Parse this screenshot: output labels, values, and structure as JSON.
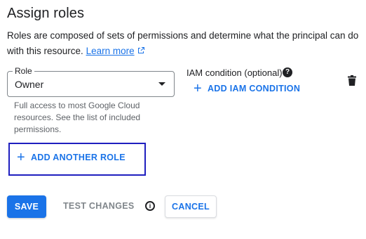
{
  "header": {
    "title": "Assign roles"
  },
  "description": {
    "text": "Roles are composed of sets of permissions and determine what the principal can do with this resource.",
    "link_label": "Learn more"
  },
  "role": {
    "label": "Role",
    "value": "Owner",
    "help": "Full access to most Google Cloud resources. See the list of included permissions."
  },
  "iam_condition": {
    "label": "IAM condition (optional)",
    "help_icon_text": "?",
    "add_label": "ADD IAM CONDITION"
  },
  "add_role": {
    "label": "ADD ANOTHER ROLE"
  },
  "footer": {
    "save_label": "SAVE",
    "test_label": "TEST CHANGES",
    "info_icon_text": "i",
    "cancel_label": "CANCEL"
  },
  "colors": {
    "accent": "#1a73e8",
    "focus_outline": "#1f1fbf",
    "text": "#202124",
    "muted": "#5f6368",
    "disabled": "#80868b"
  },
  "icons": {
    "external": "external-link-icon",
    "dropdown": "chevron-down-icon",
    "help": "help-icon",
    "delete": "trash-icon",
    "add": "plus-icon",
    "info": "info-icon"
  }
}
